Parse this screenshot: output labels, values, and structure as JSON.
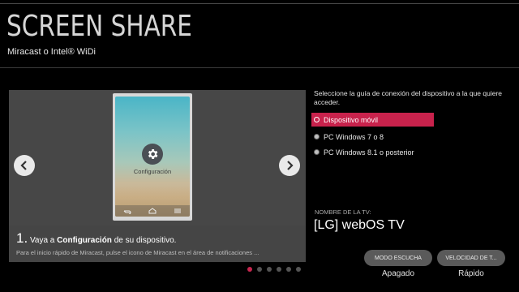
{
  "header": {
    "title": "SCREEN SHARE",
    "subtitle": "Miracast o Intel® WiDi"
  },
  "carousel": {
    "phone_label": "Configuración",
    "step_number": "1.",
    "step_text_before": " Vaya a ",
    "step_text_bold": "Configuración",
    "step_text_after": " de su dispositivo.",
    "step_sub": "Para el inicio rápido de Miracast, pulse el icono de Miracast en el área de notificaciones ...",
    "dots": [
      true,
      false,
      false,
      false,
      false,
      false
    ],
    "icons": {
      "prev": "chevron-left-icon",
      "next": "chevron-right-icon",
      "settings": "gear-icon"
    }
  },
  "panel": {
    "instruction": "Seleccione la guía de conexión del dispositivo a la que quiere acceder.",
    "options": [
      {
        "label": "Dispositivo móvil",
        "selected": true
      },
      {
        "label": "PC Windows 7 o 8",
        "selected": false
      },
      {
        "label": "PC Windows 8.1 o posterior",
        "selected": false
      }
    ],
    "tv_label": "NOMBRE DE LA TV:",
    "tv_name": "[LG] webOS TV"
  },
  "controls": {
    "listen_mode_button": "MODO ESCUCHA",
    "listen_mode_value": "Apagado",
    "speed_button": "VELOCIDAD DE T...",
    "speed_value": "Rápido"
  },
  "colors": {
    "accent": "#c8224c",
    "background": "#000000",
    "carousel_bg": "#474747"
  }
}
